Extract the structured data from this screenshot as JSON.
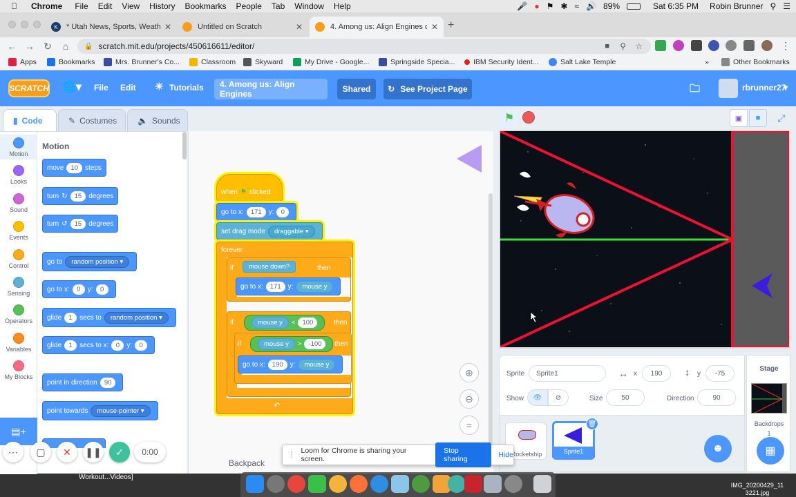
{
  "menubar": {
    "app": "Chrome",
    "items": [
      "File",
      "Edit",
      "View",
      "History",
      "Bookmarks",
      "People",
      "Tab",
      "Window",
      "Help"
    ],
    "battery": "89%",
    "clock": "Sat 6:35 PM",
    "user": "Robin Brunner"
  },
  "tabs": [
    {
      "title": "* Utah News, Sports, Weather,"
    },
    {
      "title": "Untitled on Scratch"
    },
    {
      "title": "4. Among us: Align Engines on"
    }
  ],
  "address": {
    "url": "scratch.mit.edu/projects/450616611/editor/"
  },
  "bookmarks": {
    "apps": "Apps",
    "items": [
      "Bookmarks",
      "Mrs. Brunner's Co...",
      "Classroom",
      "Skyward",
      "My Drive - Google...",
      "Springside Specia...",
      "IBM Security Ident...",
      "Salt Lake Temple"
    ],
    "other": "Other Bookmarks",
    "more": "»"
  },
  "scratch_menu": {
    "logo": "SCRATCH",
    "file": "File",
    "edit": "Edit",
    "tutorials": "Tutorials",
    "project_title": "4. Among us: Align Engines",
    "shared": "Shared",
    "see_project_page": "See Project Page",
    "username": "rbrunner27"
  },
  "editor_tabs": {
    "code": "Code",
    "costumes": "Costumes",
    "sounds": "Sounds"
  },
  "categories": [
    {
      "name": "Motion",
      "color": "#4c97ff"
    },
    {
      "name": "Looks",
      "color": "#9966ff"
    },
    {
      "name": "Sound",
      "color": "#cf63cf"
    },
    {
      "name": "Events",
      "color": "#ffbf00"
    },
    {
      "name": "Control",
      "color": "#ffab19"
    },
    {
      "name": "Sensing",
      "color": "#5cb1d6"
    },
    {
      "name": "Operators",
      "color": "#59c059"
    },
    {
      "name": "Variables",
      "color": "#ff8c1a"
    },
    {
      "name": "My Blocks",
      "color": "#ff6680"
    }
  ],
  "palette": {
    "section": "Motion",
    "move": {
      "a": "move",
      "v": "10",
      "b": "steps"
    },
    "turn_r": {
      "a": "turn",
      "v": "15",
      "b": "degrees"
    },
    "turn_l": {
      "a": "turn",
      "v": "15",
      "b": "degrees"
    },
    "goto": {
      "a": "go to",
      "dd": "random position"
    },
    "gotoxy": {
      "a": "go to x:",
      "x": "0",
      "b": "y:",
      "y": "0"
    },
    "glide1": {
      "a": "glide",
      "v": "1",
      "b": "secs to",
      "dd": "random position"
    },
    "glide2": {
      "a": "glide",
      "v": "1",
      "b": "secs to x:",
      "x": "0",
      "c": "y:",
      "y": "0"
    },
    "point_dir": {
      "a": "point in direction",
      "v": "90"
    },
    "point_towards": {
      "a": "point towards",
      "dd": "mouse-pointer"
    }
  },
  "script": {
    "hat": {
      "a": "when",
      "b": "clicked"
    },
    "goto1": {
      "a": "go to x:",
      "x": "171",
      "b": "y:",
      "y": "0"
    },
    "drag": {
      "a": "set drag mode",
      "dd": "draggable"
    },
    "forever": "forever",
    "if1": {
      "a": "if",
      "cond": "mouse down?",
      "b": "then"
    },
    "goto2": {
      "a": "go to x:",
      "x": "171",
      "b": "y:",
      "y": "mouse y"
    },
    "if2": {
      "a": "if",
      "left": "mouse y",
      "op": "<",
      "right": "100",
      "b": "then"
    },
    "if3": {
      "a": "if",
      "left": "mouse y",
      "op": ">",
      "right": "-100",
      "b": "then"
    },
    "goto3": {
      "a": "go to x:",
      "x": "190",
      "b": "y:",
      "y": "mouse y"
    }
  },
  "sprite_info": {
    "sprite_label": "Sprite",
    "sprite_name": "Sprite1",
    "x_label": "x",
    "x": "190",
    "y_label": "y",
    "y": "-75",
    "show_label": "Show",
    "size_label": "Size",
    "size": "50",
    "direction_label": "Direction",
    "direction": "90"
  },
  "sprites": [
    {
      "name": "Rocketship"
    },
    {
      "name": "Sprite1"
    }
  ],
  "stage_panel": {
    "title": "Stage",
    "backdrops": "Backdrops",
    "count": "1"
  },
  "backpack": "Backpack",
  "loom": {
    "message": "Loom for Chrome is sharing your screen.",
    "stop": "Stop sharing",
    "hide": "Hide",
    "timer": "0:00"
  },
  "desktop": {
    "left_label": "Workout...Videos]",
    "right_label": "IMG_20200429_11 3221.jpg"
  }
}
